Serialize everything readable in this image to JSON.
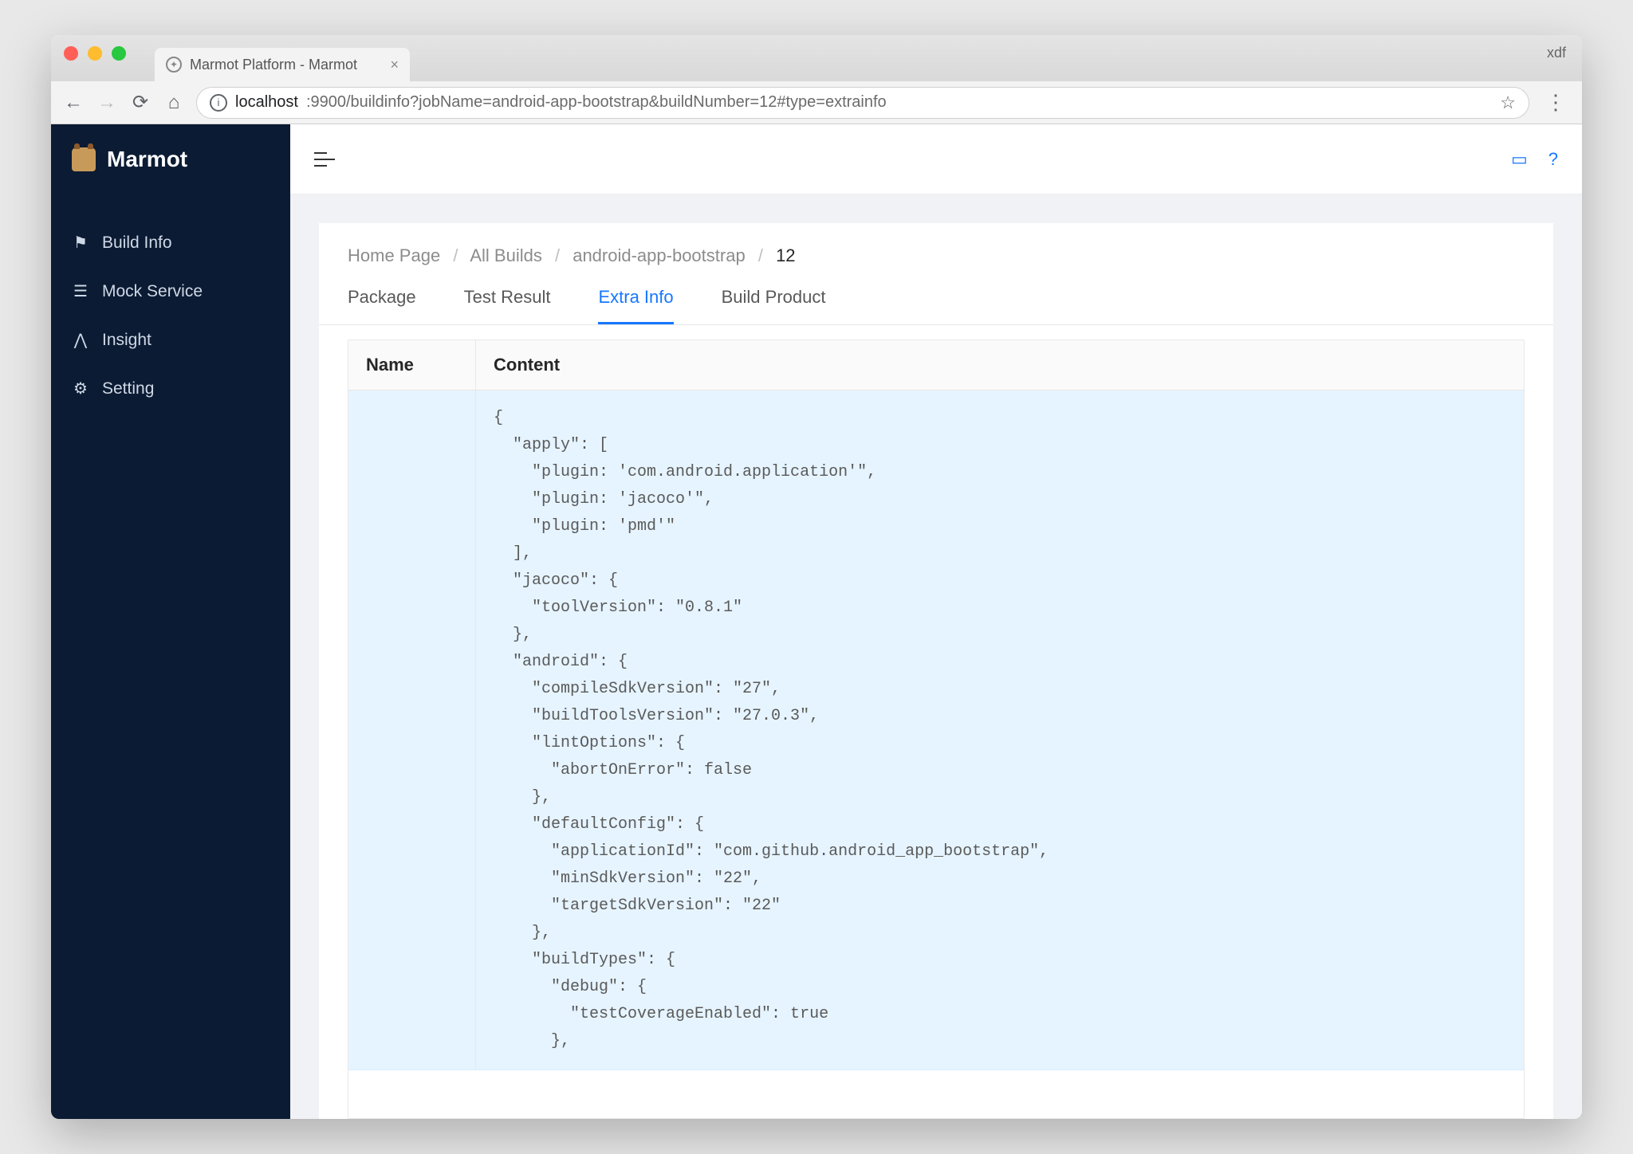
{
  "browser": {
    "tab_title": "Marmot Platform - Marmot",
    "profile": "xdf",
    "url_host": "localhost",
    "url_rest": ":9900/buildinfo?jobName=android-app-bootstrap&buildNumber=12#type=extrainfo"
  },
  "brand": {
    "name": "Marmot"
  },
  "sidebar": {
    "items": [
      {
        "icon": "flag-icon",
        "glyph": "⚑",
        "label": "Build Info"
      },
      {
        "icon": "list-icon",
        "glyph": "☰",
        "label": "Mock Service"
      },
      {
        "icon": "chart-icon",
        "glyph": "⋀",
        "label": "Insight"
      },
      {
        "icon": "gear-icon",
        "glyph": "⚙",
        "label": "Setting"
      }
    ]
  },
  "breadcrumb": {
    "items": [
      "Home Page",
      "All Builds",
      "android-app-bootstrap"
    ],
    "current": "12"
  },
  "tabs": {
    "items": [
      "Package",
      "Test Result",
      "Extra Info",
      "Build Product"
    ],
    "active": 2
  },
  "table": {
    "columns": [
      "Name",
      "Content"
    ],
    "rows": [
      {
        "name": "",
        "content": "{\n  \"apply\": [\n    \"plugin: 'com.android.application'\",\n    \"plugin: 'jacoco'\",\n    \"plugin: 'pmd'\"\n  ],\n  \"jacoco\": {\n    \"toolVersion\": \"0.8.1\"\n  },\n  \"android\": {\n    \"compileSdkVersion\": \"27\",\n    \"buildToolsVersion\": \"27.0.3\",\n    \"lintOptions\": {\n      \"abortOnError\": false\n    },\n    \"defaultConfig\": {\n      \"applicationId\": \"com.github.android_app_bootstrap\",\n      \"minSdkVersion\": \"22\",\n      \"targetSdkVersion\": \"22\"\n    },\n    \"buildTypes\": {\n      \"debug\": {\n        \"testCoverageEnabled\": true\n      },"
      }
    ]
  }
}
